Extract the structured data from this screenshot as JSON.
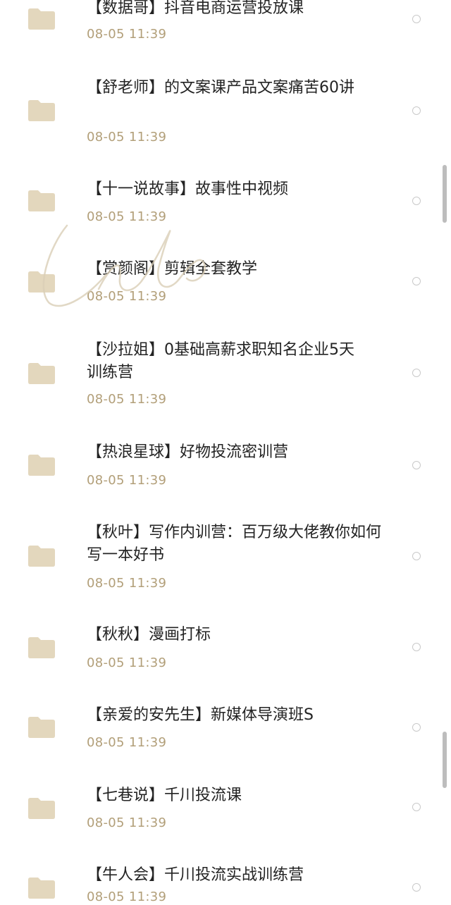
{
  "colors": {
    "folder": "#e3d7bd",
    "title": "#232323",
    "time": "#b29f79"
  },
  "files": [
    {
      "title": "【数据哥】抖音电商运营投放课",
      "time": "08-05  11:39"
    },
    {
      "title": "【舒老师】的文案课产品文案痛苦60讲",
      "time": "08-05  11:39"
    },
    {
      "title": "【十一说故事】故事性中视频",
      "time": "08-05  11:39"
    },
    {
      "title": "【赏颜阁】剪辑全套教学",
      "time": "08-05  11:39"
    },
    {
      "title": "【沙拉姐】0基础高薪求职知名企业5天训练营",
      "time": "08-05  11:39"
    },
    {
      "title": "【热浪星球】好物投流密训营",
      "time": "08-05  11:39"
    },
    {
      "title": "【秋叶】写作内训营：百万级大佬教你如何写一本好书",
      "time": "08-05  11:39"
    },
    {
      "title": "【秋秋】漫画打标",
      "time": "08-05  11:39"
    },
    {
      "title": "【亲爱的安先生】新媒体导演班S",
      "time": "08-05  11:39"
    },
    {
      "title": "【七巷说】千川投流课",
      "time": "08-05  11:39"
    },
    {
      "title": "【牛人会】千川投流实战训练营",
      "time": "08-05  11:39"
    }
  ]
}
